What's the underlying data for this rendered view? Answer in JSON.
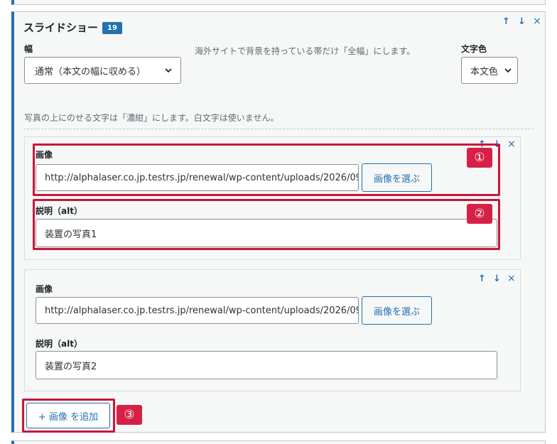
{
  "block": {
    "title": "スライドショー",
    "badge": "19",
    "controls": {
      "up": "↑",
      "down": "↓",
      "remove": "×"
    }
  },
  "settings": {
    "width_label": "幅",
    "width_value": "通常（本文の幅に収める）",
    "width_help": "海外サイトで背景を持っている帯だけ「全幅」にします。",
    "text_color_label": "文字色",
    "text_color_value": "本文色",
    "note": "写真の上にのせる文字は「濃紺」にします。白文字は使いません。"
  },
  "items": [
    {
      "image_label": "画像",
      "image_url": "http://alphalaser.co.jp.testrs.jp/renewal/wp-content/uploads/2026/09,",
      "choose_button": "画像を選ぶ",
      "alt_label": "説明（alt）",
      "alt_value": "装置の写真1"
    },
    {
      "image_label": "画像",
      "image_url": "http://alphalaser.co.jp.testrs.jp/renewal/wp-content/uploads/2026/09,",
      "choose_button": "画像を選ぶ",
      "alt_label": "説明（alt）",
      "alt_value": "装置の写真2"
    }
  ],
  "add_button": "+ 画像 を追加",
  "annotations": {
    "one": "①",
    "two": "②",
    "three": "③"
  },
  "colors": {
    "accent": "#2271b1",
    "annotation": "#d62045",
    "panel_bg": "#f6f7f7"
  }
}
